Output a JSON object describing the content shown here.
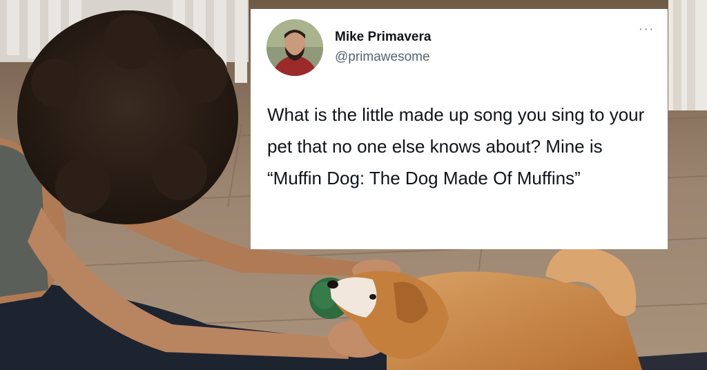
{
  "tweet": {
    "author_name": "Mike Primavera",
    "author_handle": "@primawesome",
    "more_icon": "more-dots-icon",
    "text": "What is the little made up song you sing to your pet that no one else knows about? Mine is “Muffin Dog: The Dog Made Of Muffins”"
  },
  "background": {
    "subject": "photo-scene",
    "colors": {
      "floor": "#a28a72",
      "hair": "#2a1f18",
      "skin": "#b07a55",
      "dog": "#c98a45",
      "toy": "#2e6b3f"
    }
  }
}
